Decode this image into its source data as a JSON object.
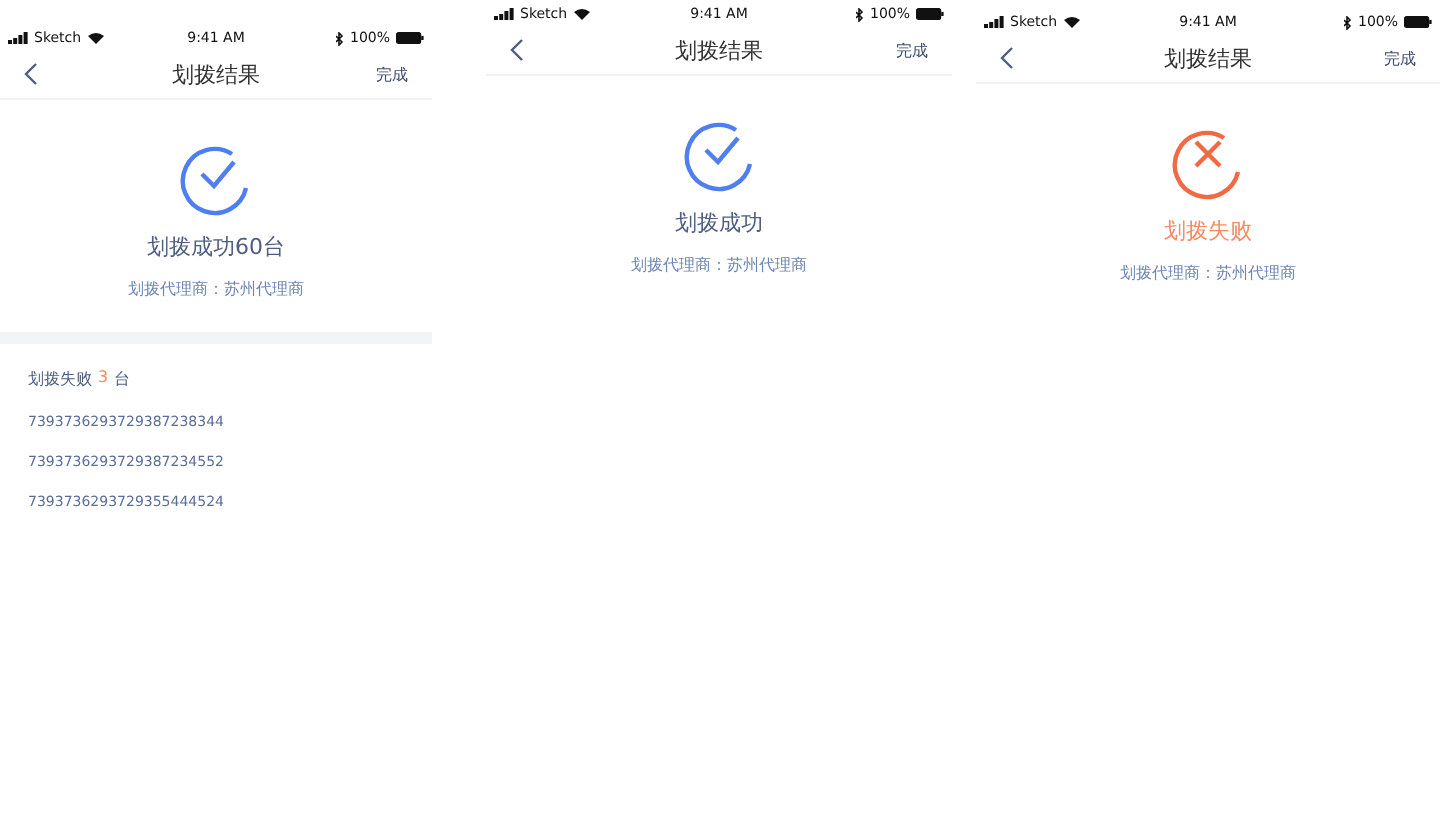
{
  "screens": [
    {
      "status_bar": {
        "carrier": "Sketch",
        "time": "9:41 AM",
        "battery": "100%"
      },
      "nav": {
        "title": "划拨结果",
        "action": "完成"
      },
      "result": {
        "kind": "success",
        "text": "划拨成功60台",
        "agent": "划拨代理商：苏州代理商"
      },
      "failures": {
        "label": "划拨失败",
        "count": "3",
        "unit": "台",
        "items": [
          "7393736293729387238344",
          "7393736293729387234552",
          "7393736293729355444524"
        ]
      }
    },
    {
      "status_bar": {
        "carrier": "Sketch",
        "time": "9:41 AM",
        "battery": "100%"
      },
      "nav": {
        "title": "划拨结果",
        "action": "完成"
      },
      "result": {
        "kind": "success",
        "text": "划拨成功",
        "agent": "划拨代理商：苏州代理商"
      }
    },
    {
      "status_bar": {
        "carrier": "Sketch",
        "time": "9:41 AM",
        "battery": "100%"
      },
      "nav": {
        "title": "划拨结果",
        "action": "完成"
      },
      "result": {
        "kind": "failure",
        "text": "划拨失败",
        "agent": "划拨代理商：苏州代理商"
      }
    }
  ]
}
